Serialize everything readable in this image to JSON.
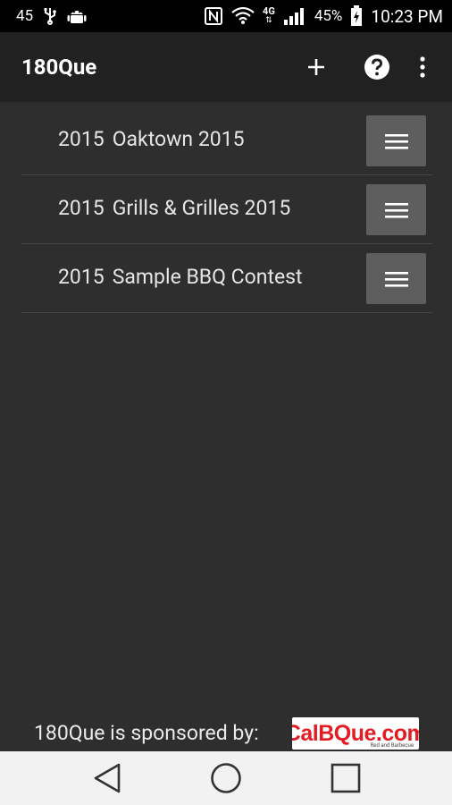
{
  "status_bar": {
    "notification_count": "45",
    "battery": "45%",
    "network": "4G",
    "time": "10:23 PM",
    "icons": [
      "usb-icon",
      "android-icon",
      "nfc-icon",
      "wifi-icon",
      "signal-icon",
      "battery-icon"
    ]
  },
  "app_bar": {
    "title": "180Que",
    "actions": [
      "add-icon",
      "help-icon",
      "more-vert-icon"
    ]
  },
  "contests": [
    {
      "year": "2015",
      "name": "Oaktown 2015"
    },
    {
      "year": "2015",
      "name": "Grills & Grilles 2015"
    },
    {
      "year": "2015",
      "name": "Sample BBQ Contest"
    }
  ],
  "sponsor": {
    "text": "180Que is sponsored by:",
    "logo_cal": "Cal",
    "logo_bque": "BQue",
    "logo_com": ".com",
    "logo_tagline": "Red and Barbecue"
  },
  "colors": {
    "background": "#2e2e2e",
    "app_bar": "#212121",
    "row_button": "#5e5e5e",
    "logo_red": "#e31b23"
  }
}
